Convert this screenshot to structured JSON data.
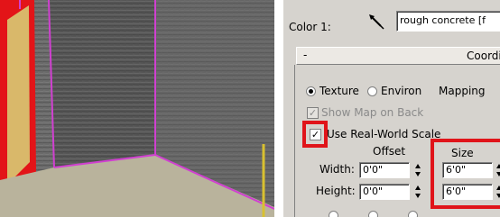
{
  "material_editor": {
    "color_label": "Color 1:",
    "map_name": "rough concrete [f",
    "rollout_collapse": "-",
    "rollout_title": "Coordin",
    "source_options": [
      "Texture",
      "Environ",
      "Mapping"
    ],
    "selected_source": "Texture",
    "show_map_on_back": "Show Map on Back",
    "use_real_world_scale": "Use Real-World Scale",
    "offset_header": "Offset",
    "size_header": "Size",
    "width_label": "Width:",
    "height_label": "Height:",
    "offset_width": "0'0\"",
    "offset_height": "0'0\"",
    "size_width": "6'0\"",
    "size_height": "6'0\""
  },
  "colors": {
    "highlight": "#e0141a",
    "edge_selection": "#d040d0",
    "panel_bg": "#d6d3ce"
  }
}
